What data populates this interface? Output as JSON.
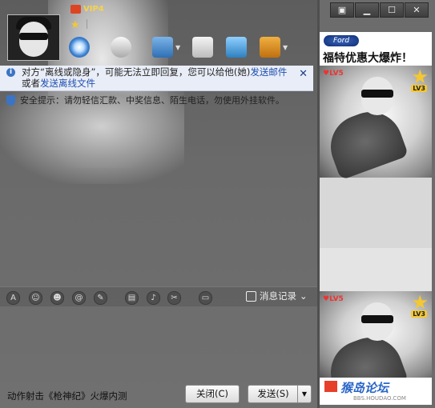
{
  "window": {
    "title_buttons": [
      "▣",
      "▁",
      "☐",
      "✕"
    ]
  },
  "profile": {
    "vip_label": "VIP4"
  },
  "notice": {
    "text_before": "对方“离线或隐身”，可能无法立即回复，您可以给他(她)",
    "link_mail": "发送邮件",
    "text_mid": "或者",
    "link_offline": "发送离线文件",
    "close_symbol": "✕"
  },
  "warning": {
    "text": "安全提示：请勿轻信汇款、中奖信息、陌生电话，勿使用外挂软件。"
  },
  "format_toolbar": {
    "icons": [
      "A",
      "☺",
      "☻",
      "@",
      "✎",
      "▤",
      "♪",
      "✂",
      "▭"
    ],
    "history_label": "消息记录"
  },
  "footer": {
    "status_text": "动作射击《枪神纪》火爆内测",
    "close_button": "关闭(C)",
    "send_button": "发送(S)",
    "send_arrow": "▼"
  },
  "ad": {
    "brand": "Ford",
    "title": "福特优惠大爆炸！",
    "lvs_label": "♥LV5",
    "lv3_label": "LV3",
    "footer_brand": "猴岛论坛",
    "footer_url": "BBS.HOUDAO.COM"
  },
  "colors": {
    "accent_link": "#1d4fb0",
    "notice_bg": "#e9edf7",
    "window_bg": "#6c6c6c"
  },
  "icons": {
    "toolbar": [
      "video-call-icon",
      "voice-call-icon",
      "send-file-icon",
      "app-icon",
      "remote-assist-icon",
      "more-icon"
    ]
  }
}
